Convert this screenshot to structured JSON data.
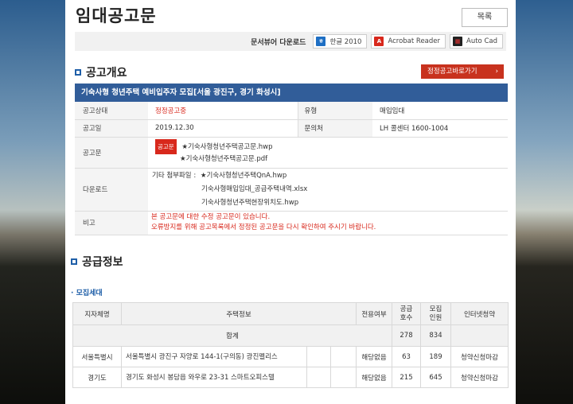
{
  "page": {
    "title": "임대공고문",
    "list_button": "목록"
  },
  "viewer": {
    "label": "문서뷰어 다운로드",
    "buttons": [
      {
        "label": "한글 2010",
        "icon": "hwp-icon",
        "color": "#1e6fc4"
      },
      {
        "label": "Acrobat Reader",
        "icon": "pdf-icon",
        "color": "#d8281c"
      },
      {
        "label": "Auto Cad",
        "icon": "autocad-icon",
        "color": "#b8261a"
      }
    ]
  },
  "overview": {
    "section_title": "공고개요",
    "go_button": "정정공고바로가기",
    "notice_title": "기숙사형 청년주택 예비입주자 모집[서울 광진구, 경기 화성시]",
    "status_label": "공고상태",
    "status_value": "정정공고중",
    "type_label": "유형",
    "type_value": "매입임대",
    "date_label": "공고일",
    "date_value": "2019.12.30",
    "contact_label": "문의처",
    "contact_value": "LH 콜센터 1600-1004",
    "notice_label": "공고문",
    "notice_tag": "공고문",
    "notice_files": [
      "★기숙사형청년주택공고문.hwp",
      "★기숙사형청년주택공고문.pdf"
    ],
    "download_label": "다운로드",
    "other_label": "기타 첨부파일 :",
    "other_files": [
      "★기숙사형청년주택QnA.hwp",
      "기숙사형매입임대_공급주택내역.xlsx",
      "기숙사형청년주택현장위치도.hwp"
    ],
    "remark_label": "비고",
    "remark_lines": [
      "본 공고문에 대한 수정 공고문이 있습니다.",
      "오류방지를 위해 공고목록에서 정정된 공고문을 다시  확인하여 주시기 바랍니다."
    ]
  },
  "supply": {
    "section_title": "공급정보",
    "sub_title": "모집세대",
    "headers": {
      "region": "지자체명",
      "house": "주택정보",
      "exclusive": "전용여부",
      "supply": "공급\n호수",
      "recruit": "모집\n인원",
      "internet": "인터넷청약"
    },
    "total": {
      "label": "합계",
      "supply": "278",
      "recruit": "834"
    },
    "rows": [
      {
        "region": "서울특별시",
        "address": "서울특별시 광진구 자양로 144-1(구의동) 광진펠리스",
        "exclusive": "해당없음",
        "supply": "63",
        "recruit": "189",
        "internet": "청약신청마감"
      },
      {
        "region": "경기도",
        "address": "경기도 화성시 봉담읍 와우로 23-31 스마트오피스텔",
        "exclusive": "해당없음",
        "supply": "215",
        "recruit": "645",
        "internet": "청약신청마감"
      }
    ]
  }
}
